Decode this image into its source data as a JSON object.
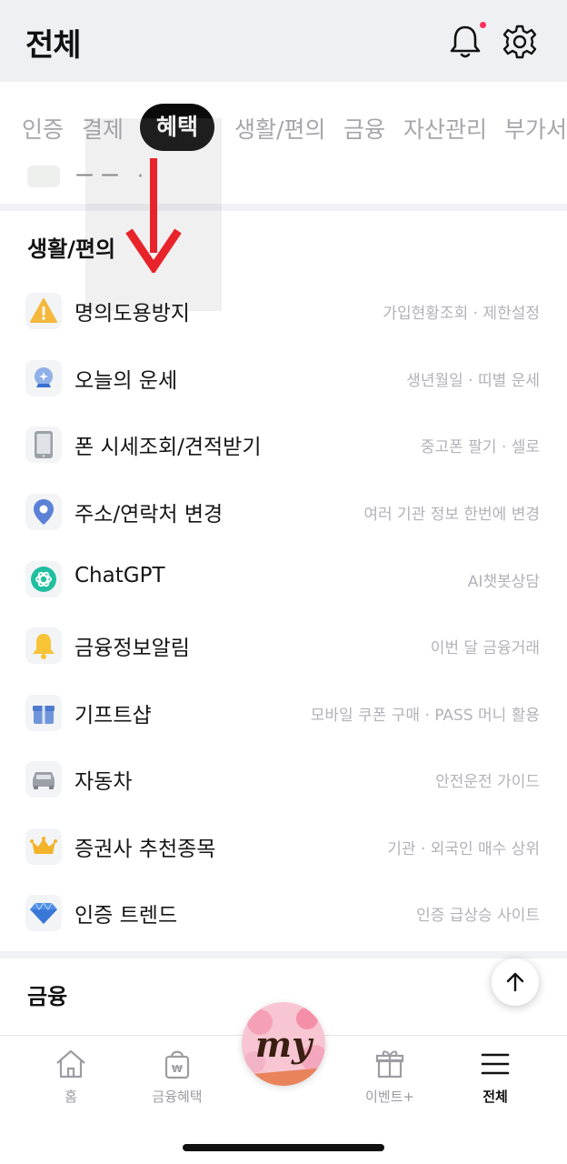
{
  "header": {
    "title": "전체"
  },
  "tabs": [
    {
      "label": "인증",
      "active": false
    },
    {
      "label": "결제",
      "active": false
    },
    {
      "label": "혜택",
      "active": true
    },
    {
      "label": "생활/편의",
      "active": false
    },
    {
      "label": "금융",
      "active": false
    },
    {
      "label": "자산관리",
      "active": false
    },
    {
      "label": "부가서",
      "active": false
    }
  ],
  "peek_row": {
    "text": "ーー ·"
  },
  "section_lifestyle": {
    "title": "생활/편의",
    "items": [
      {
        "label": "명의도용방지",
        "desc": "가입현황조회 · 제한설정",
        "icon": "warning-icon"
      },
      {
        "label": "오늘의 운세",
        "desc": "생년월일 · 띠별 운세",
        "icon": "crystal-ball-icon"
      },
      {
        "label": "폰 시세조회/견적받기",
        "desc": "중고폰 팔기 · 셀로",
        "icon": "phone-icon"
      },
      {
        "label": "주소/연락처 변경",
        "desc": "여러 기관 정보 한번에 변경",
        "icon": "location-pin-icon"
      },
      {
        "label": "ChatGPT",
        "desc": "AI챗봇상담",
        "icon": "chatgpt-icon"
      },
      {
        "label": "금융정보알림",
        "desc": "이번 달 금융거래",
        "icon": "bell-icon"
      },
      {
        "label": "기프트샵",
        "desc": "모바일 쿠폰 구매 · PASS 머니 활용",
        "icon": "gift-icon"
      },
      {
        "label": "자동차",
        "desc": "안전운전 가이드",
        "icon": "car-icon"
      },
      {
        "label": "증권사 추천종목",
        "desc": "기관 · 외국인 매수 상위",
        "icon": "crown-icon"
      },
      {
        "label": "인증 트렌드",
        "desc": "인증 급상승 사이트",
        "icon": "diamond-icon"
      }
    ]
  },
  "section_finance": {
    "title": "금융"
  },
  "bottom_nav": {
    "home": "홈",
    "finance_benefit": "금융혜택",
    "my": "my",
    "event": "이벤트+",
    "all": "전체"
  },
  "colors": {
    "accent_red": "#e8232a",
    "active_tab_bg": "#0b0b0b",
    "header_bg": "#eff0f3",
    "notification_dot": "#ff2e5c"
  }
}
